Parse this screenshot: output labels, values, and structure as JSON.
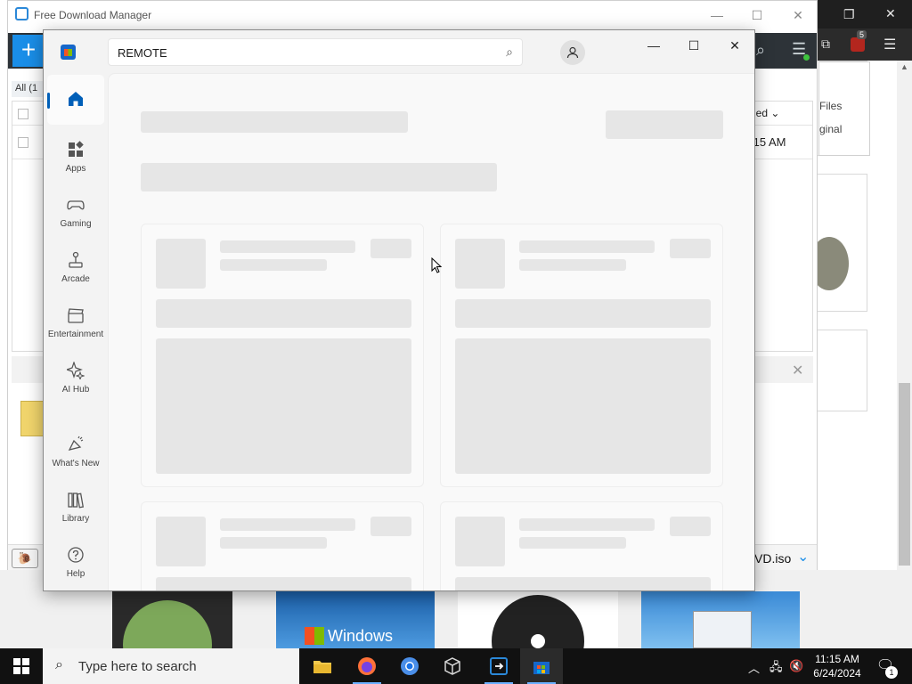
{
  "fdm": {
    "title": "Free Download Manager",
    "add_button": "+",
    "tab_all": "All (1",
    "column_sorted": "ded ⌄",
    "row_time": ":15 AM",
    "file_name": "VD.iso",
    "right_panel_files": "Files",
    "right_panel_original": "ginal"
  },
  "products": {
    "windows_banner": "Windows"
  },
  "store": {
    "search_value": "REMOTE",
    "nav": [
      {
        "label": "",
        "icon": "home-icon"
      },
      {
        "label": "Apps",
        "icon": "apps-icon"
      },
      {
        "label": "Gaming",
        "icon": "gamepad-icon"
      },
      {
        "label": "Arcade",
        "icon": "joystick-icon"
      },
      {
        "label": "Entertainment",
        "icon": "clapperboard-icon"
      },
      {
        "label": "AI Hub",
        "icon": "sparkle-icon"
      },
      {
        "label": "What's New",
        "icon": "megaphone-icon"
      },
      {
        "label": "Library",
        "icon": "library-icon"
      },
      {
        "label": "Help",
        "icon": "help-icon"
      }
    ]
  },
  "browser": {
    "extension_badge": "5"
  },
  "taskbar": {
    "search_placeholder": "Type here to search",
    "time": "11:15 AM",
    "date": "6/24/2024",
    "notification_count": "1"
  },
  "colors": {
    "accent": "#005fb8",
    "skeleton": "#e6e6e6",
    "fdm_blue": "#1a8ee8",
    "taskbar": "#111111"
  }
}
